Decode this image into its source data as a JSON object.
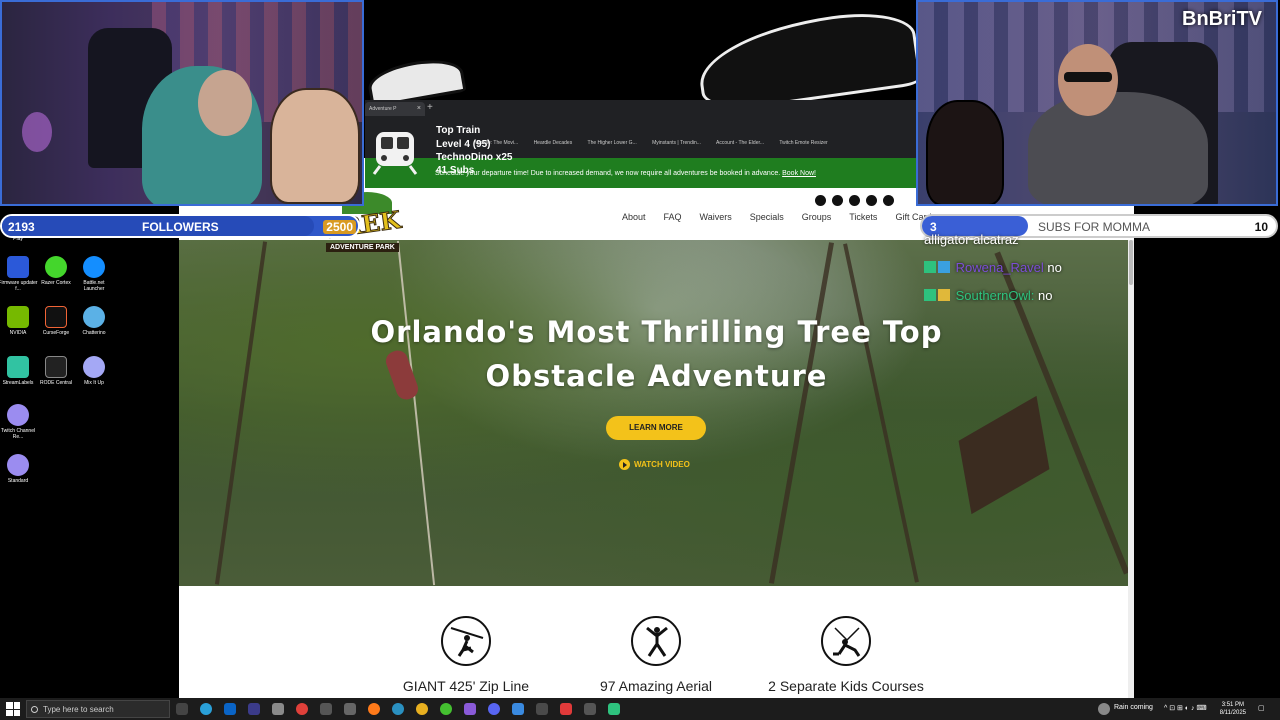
{
  "desktop": {
    "icons": [
      {
        "label": "Play",
        "icon": "play-icon",
        "color": "#0a0a0a"
      },
      {
        "label": "Firmware updater f...",
        "icon": "firmware-updater-icon",
        "color": "#2b59d9"
      },
      {
        "label": "Razer Cortex",
        "icon": "razer-cortex-icon",
        "color": "#44d62c"
      },
      {
        "label": "Battle.net Launcher",
        "icon": "battlenet-icon",
        "color": "#148eff"
      },
      {
        "label": "NVIDIA",
        "icon": "nvidia-icon",
        "color": "#76b900"
      },
      {
        "label": "CurseForge",
        "icon": "curseforge-icon",
        "color": "#f16436"
      },
      {
        "label": "Chatterino",
        "icon": "chatterino-icon",
        "color": "#5bb1e6"
      },
      {
        "label": "StreamLabels",
        "icon": "streamlabels-icon",
        "color": "#31c3a2"
      },
      {
        "label": "RODE Central",
        "icon": "rode-central-icon",
        "color": "#222222"
      },
      {
        "label": "Mix It Up",
        "icon": "mix-it-up-icon",
        "color": "#a4a8f5"
      },
      {
        "label": "Twitch Channel Re...",
        "icon": "twitch-channel-icon",
        "color": "#9b8cf0"
      },
      {
        "label": "Standard",
        "icon": "standard-icon",
        "color": "#9b8cf0"
      }
    ]
  },
  "browser": {
    "tab_label": "Adventure P",
    "bookmarks": [
      "Wordle: The Movi...",
      "Heardle Decades",
      "The Higher Lower G...",
      "Myinstants | Trendin...",
      "Account - The Elder...",
      "Twitch Emote Resizer"
    ]
  },
  "site": {
    "banner_text": "Schedule your departure time! Due to increased demand, we now require all adventures be booked in advance.",
    "banner_link": "Book Now!",
    "logo_word": "TREK",
    "logo_sub": "ADVENTURE PARK",
    "nav": [
      "About",
      "FAQ",
      "Waivers",
      "Specials",
      "Groups",
      "Tickets",
      "Gift Cards"
    ],
    "hero_title_line1": "Orlando's Most Thrilling Tree Top",
    "hero_title_line2": "Obstacle Adventure",
    "learn_more": "LEARN MORE",
    "watch_video": "WATCH VIDEO",
    "features": [
      {
        "label": "GIANT 425' Zip Line",
        "icon": "zipline-icon"
      },
      {
        "label": "97 Amazing Aerial",
        "icon": "aerial-climber-icon"
      },
      {
        "label": "2 Separate Kids Courses",
        "icon": "kids-course-icon"
      }
    ]
  },
  "overlay": {
    "train_title": "Top Train",
    "train_level": "Level 4  (95)",
    "train_user": "TechnoDino x25",
    "train_subs": "41 Subs",
    "brand": "BnBriTV",
    "followers": {
      "count": "2193",
      "label": "FOLLOWERS",
      "goal": "2500",
      "progress": 0.877
    },
    "subs": {
      "count": "3",
      "label": "SUBS FOR MOMMA",
      "goal": "10",
      "progress": 0.3
    },
    "chat": [
      {
        "user": "",
        "message": "alligator alcatraz"
      },
      {
        "user": "Rowena_Ravel",
        "message": "no"
      },
      {
        "user": "SouthernOwl:",
        "message": "no"
      }
    ]
  },
  "taskbar": {
    "search_placeholder": "Type here to search",
    "weather": "Rain coming",
    "time": "3:51 PM",
    "date": "8/11/2025"
  },
  "colors": {
    "goal_blue": "#2f57c9",
    "site_green": "#1f7d1f",
    "accent_yellow": "#f3c21a"
  }
}
